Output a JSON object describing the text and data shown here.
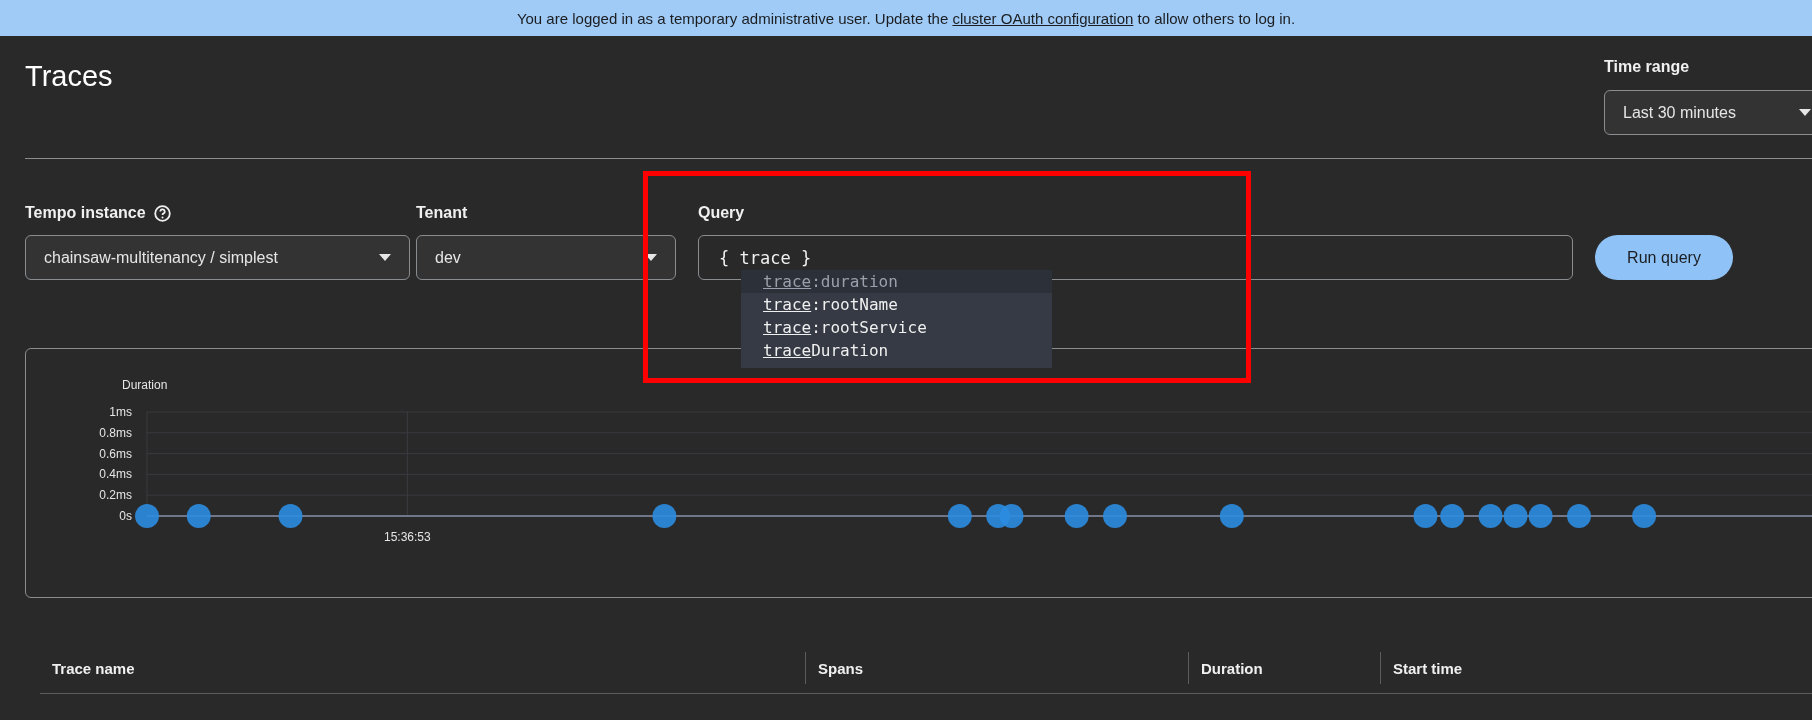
{
  "banner": {
    "before": "You are logged in as a temporary administrative user. Update the",
    "link": "cluster OAuth configuration",
    "after": "to allow others to log in."
  },
  "page": {
    "title": "Traces"
  },
  "time_range": {
    "label": "Time range",
    "value": "Last 30 minutes"
  },
  "filters": [
    {
      "label": "Tempo instance",
      "help": true,
      "value": "chainsaw-multitenancy / simplest"
    },
    {
      "label": "Tenant",
      "help": false,
      "value": "dev"
    }
  ],
  "query": {
    "label": "Query",
    "value": "{ trace }",
    "button": "Run query",
    "suggestions": [
      {
        "match": "trace",
        "rest": ":duration",
        "dimmed": true
      },
      {
        "match": "trace",
        "rest": ":rootName",
        "dimmed": false
      },
      {
        "match": "trace",
        "rest": ":rootService",
        "dimmed": false
      },
      {
        "match": "trace",
        "rest": "Duration",
        "dimmed": false
      }
    ]
  },
  "chart": {
    "axis_title": "Duration",
    "y_labels": [
      "1ms",
      "0.8ms",
      "0.6ms",
      "0.4ms",
      "0.2ms",
      "0s"
    ],
    "x_labels": [
      "15:36:53"
    ]
  },
  "table": {
    "columns": [
      "Trace name",
      "Spans",
      "Duration",
      "Start time"
    ]
  }
}
